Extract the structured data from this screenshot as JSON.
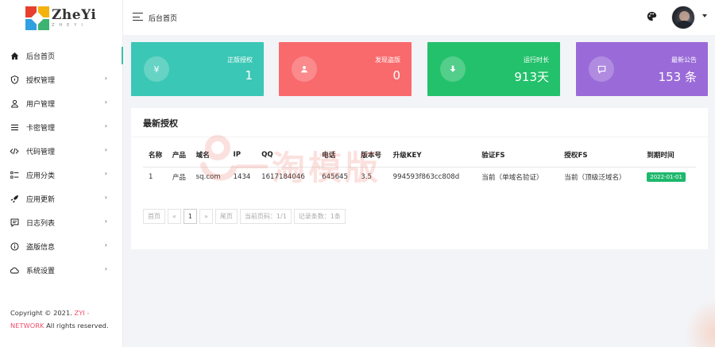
{
  "brand": {
    "name": "ZheYi",
    "tagline": "ZHEYI"
  },
  "header": {
    "title": "后台首页"
  },
  "sidebar": {
    "items": [
      {
        "label": "后台首页",
        "icon": "home-icon",
        "active": true,
        "has_children": false
      },
      {
        "label": "授权管理",
        "icon": "shield-icon",
        "has_children": true
      },
      {
        "label": "用户管理",
        "icon": "user-icon",
        "has_children": true
      },
      {
        "label": "卡密管理",
        "icon": "list-icon",
        "has_children": true
      },
      {
        "label": "代码管理",
        "icon": "code-icon",
        "has_children": true
      },
      {
        "label": "应用分类",
        "icon": "category-icon",
        "has_children": true
      },
      {
        "label": "应用更新",
        "icon": "rocket-icon",
        "has_children": true
      },
      {
        "label": "日志列表",
        "icon": "message-icon",
        "has_children": true
      },
      {
        "label": "盗版信息",
        "icon": "info-icon",
        "has_children": true
      },
      {
        "label": "系统设置",
        "icon": "cloud-icon",
        "has_children": true
      }
    ],
    "arrow": "›"
  },
  "footer": {
    "prefix": "Copyright © 2021.",
    "link1": "ZYI -",
    "link2": "NETWORK",
    "suffix": "All rights reserved."
  },
  "cards": [
    {
      "label": "正版授权",
      "value": "1",
      "icon_glyph": "¥",
      "icon": "yen-icon",
      "color": "#3bc7b5"
    },
    {
      "label": "发现盗版",
      "value": "0",
      "icon_glyph": "",
      "icon": "user-icon",
      "color": "#f96a6c"
    },
    {
      "label": "运行时长",
      "value": "913天",
      "icon_glyph": "",
      "icon": "download-icon",
      "color": "#23c16b"
    },
    {
      "label": "最新公告",
      "value": "153 条",
      "icon_glyph": "",
      "icon": "chat-icon",
      "color": "#9a6bd8"
    }
  ],
  "panel": {
    "title": "最新授权",
    "watermark": "一淘模版",
    "columns": [
      "名称",
      "产品",
      "域名",
      "IP",
      "QQ",
      "电话",
      "版本号",
      "升级KEY",
      "验证FS",
      "授权FS",
      "到期时间"
    ],
    "rows": [
      [
        "1",
        "产品",
        "sq.com",
        "1434",
        "1617184046",
        "645645",
        "3.5",
        "994593f863cc808d",
        "当前（单域名验证）",
        "当前（顶级泛域名）",
        "2022-01-01"
      ]
    ],
    "pager": {
      "first": "首页",
      "prev": "«",
      "current": "1",
      "next": "»",
      "last": "尾页",
      "page_info": "当前页码：1/1",
      "count_info": "记录条数：1条"
    }
  },
  "colors": {
    "accent": "#3bc0a8",
    "badge": "#1fb86d",
    "highlight": "#ee4d6a"
  }
}
